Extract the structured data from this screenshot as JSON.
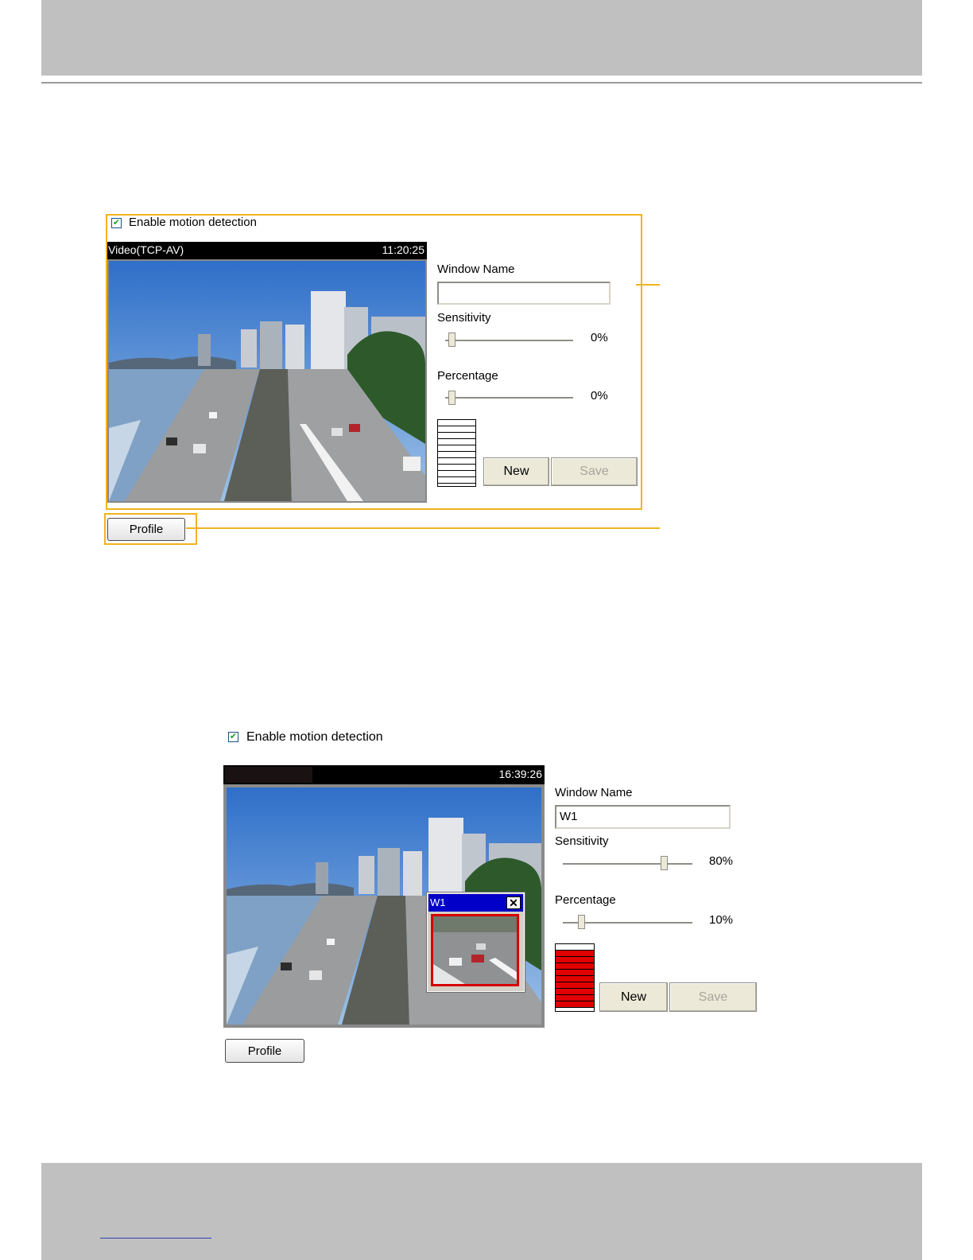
{
  "screenshot1": {
    "enable_label": "Enable motion detection",
    "video_title": "Video(TCP-AV)",
    "timestamp": "11:20:25",
    "window_name_label": "Window Name",
    "window_name_value": "",
    "sensitivity_label": "Sensitivity",
    "sensitivity_value": "0%",
    "percentage_label": "Percentage",
    "percentage_value": "0%",
    "new_label": "New",
    "save_label": "Save",
    "profile_label": "Profile",
    "meter_level": 0
  },
  "screenshot2": {
    "enable_label": "Enable motion detection",
    "video_title": "",
    "timestamp": "16:39:26",
    "window_name_label": "Window Name",
    "window_name_value": "W1",
    "sensitivity_label": "Sensitivity",
    "sensitivity_value": "80%",
    "percentage_label": "Percentage",
    "percentage_value": "10%",
    "new_label": "New",
    "save_label": "Save",
    "profile_label": "Profile",
    "motion_window_label": "W1",
    "meter_level": 0.85
  },
  "colors": {
    "callout": "#f0b41c",
    "meter_active": "#e00000",
    "window_title_bg": "#0000c8"
  },
  "icons": {
    "checkbox": "check-icon",
    "close": "close-icon"
  }
}
